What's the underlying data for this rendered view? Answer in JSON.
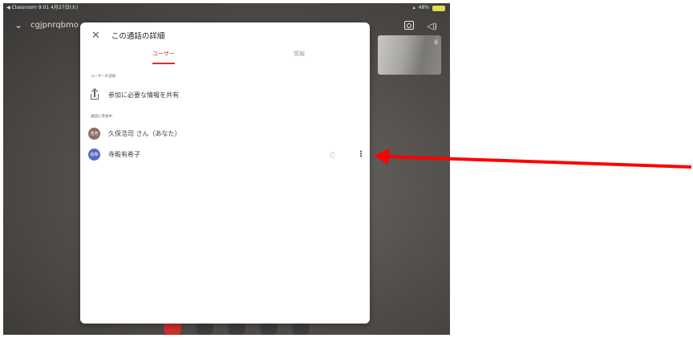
{
  "status_bar": {
    "left_text": "◀ Classroom  9:01  4月27日(火)",
    "right_text": "48%"
  },
  "call": {
    "meeting_code": "cgjpnrqbmo"
  },
  "panel": {
    "title": "この通話の詳細",
    "tabs": [
      {
        "label": "ユーザー",
        "active": true
      },
      {
        "label": "情報",
        "active": false
      }
    ],
    "section_user_add": "ユーザーの追加",
    "share_label": "参加に必要な情報を共有",
    "section_in_call": "通話に参加中",
    "participants": [
      {
        "avatar_text": "浩司",
        "name": "久保浩司 さん（あなた）",
        "avatar_color": "#8d6e63"
      },
      {
        "avatar_text": "有希",
        "name": "寺殿有希子",
        "avatar_color": "#5c6bc0"
      }
    ]
  },
  "colors": {
    "accent": "#d93025",
    "annotation_arrow": "#ff0000"
  },
  "icons": [
    "back-icon",
    "chevron-down-icon",
    "camera-flip-icon",
    "speaker-icon",
    "close-icon",
    "share-icon",
    "mic-off-icon",
    "more-vert-icon"
  ]
}
